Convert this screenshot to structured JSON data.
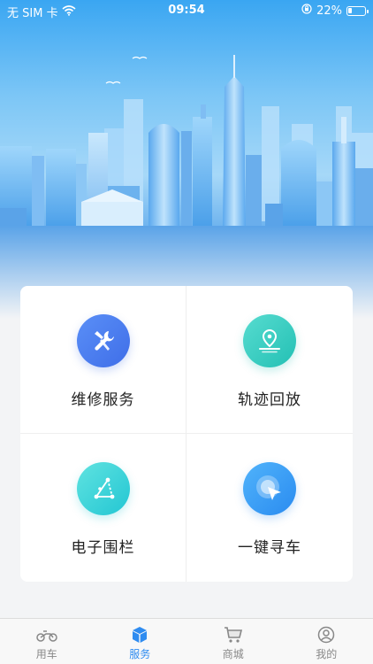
{
  "status_bar": {
    "carrier": "无 SIM 卡",
    "time": "09:54",
    "battery": "22%",
    "battery_level": 0.22
  },
  "services": [
    {
      "label": "维修服务",
      "icon": "wrench-screwdriver-icon"
    },
    {
      "label": "轨迹回放",
      "icon": "location-pin-icon"
    },
    {
      "label": "电子围栏",
      "icon": "geofence-triangle-icon"
    },
    {
      "label": "一键寻车",
      "icon": "cursor-target-icon"
    }
  ],
  "tabs": [
    {
      "label": "用车",
      "icon": "scooter-icon",
      "active": false
    },
    {
      "label": "服务",
      "icon": "box-icon",
      "active": true
    },
    {
      "label": "商城",
      "icon": "cart-icon",
      "active": false
    },
    {
      "label": "我的",
      "icon": "user-icon",
      "active": false
    }
  ],
  "colors": {
    "accent": "#2f8cf0",
    "tab_inactive": "#888888"
  }
}
